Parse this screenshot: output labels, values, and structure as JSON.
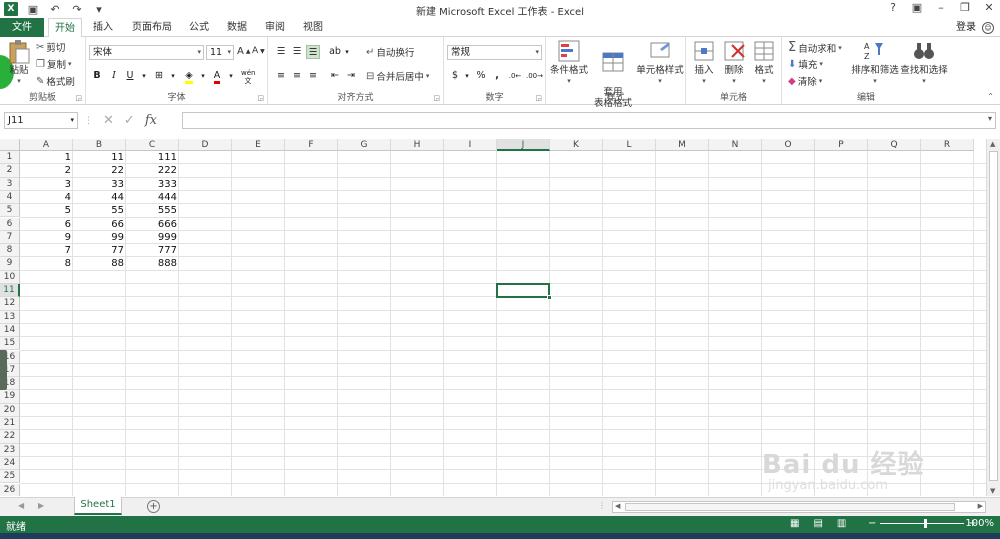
{
  "title_bar": {
    "title": "新建 Microsoft Excel 工作表 - Excel",
    "help": "?",
    "login": "登录"
  },
  "tabs": [
    "文件",
    "开始",
    "插入",
    "页面布局",
    "公式",
    "数据",
    "审阅",
    "视图"
  ],
  "active_tab": "开始",
  "ribbon": {
    "clipboard": {
      "paste": "粘贴",
      "cut": "剪切",
      "copy": "复制",
      "format_painter": "格式刷",
      "label": "剪贴板"
    },
    "font": {
      "name": "宋体",
      "size": "11",
      "bold": "B",
      "italic": "I",
      "underline": "U",
      "font_color": "A",
      "wen": "wén",
      "label": "字体"
    },
    "alignment": {
      "wrap": "自动换行",
      "merge": "合并后居中",
      "label": "对齐方式"
    },
    "number": {
      "format": "常规",
      "percent": "%",
      "comma": ",",
      "label": "数字"
    },
    "styles": {
      "conditional": "条件格式",
      "table": "套用\n表格格式",
      "cell": "单元格样式",
      "label": "样式"
    },
    "cells": {
      "insert": "插入",
      "delete": "删除",
      "format": "格式",
      "label": "单元格"
    },
    "editing": {
      "autosum": "自动求和",
      "fill": "填充",
      "clear": "清除",
      "sort": "排序和筛选",
      "find": "查找和选择",
      "label": "编辑"
    }
  },
  "formula_bar": {
    "name_box": "J11",
    "formula": ""
  },
  "columns": [
    "A",
    "B",
    "C",
    "D",
    "E",
    "F",
    "G",
    "H",
    "I",
    "J",
    "K",
    "L",
    "M",
    "N",
    "O",
    "P",
    "Q",
    "R"
  ],
  "selected_column": "J",
  "rows": [
    "1",
    "2",
    "3",
    "4",
    "5",
    "6",
    "7",
    "8",
    "9",
    "10",
    "11",
    "12",
    "13",
    "14",
    "15",
    "16",
    "17",
    "18",
    "19",
    "20",
    "21",
    "22",
    "23",
    "24",
    "25",
    "26"
  ],
  "selected_row": "11",
  "cells": [
    [
      "1",
      "11",
      "111"
    ],
    [
      "2",
      "22",
      "222"
    ],
    [
      "3",
      "33",
      "333"
    ],
    [
      "4",
      "44",
      "444"
    ],
    [
      "5",
      "55",
      "555"
    ],
    [
      "6",
      "66",
      "666"
    ],
    [
      "9",
      "99",
      "999"
    ],
    [
      "7",
      "77",
      "777"
    ],
    [
      "8",
      "88",
      "888"
    ]
  ],
  "sheet_tabs": {
    "active": "Sheet1",
    "add": "+"
  },
  "status": {
    "text": "就绪",
    "zoom": "100%",
    "zoom_minus": "−",
    "zoom_plus": "+"
  },
  "watermark": {
    "brand": "Bai du 经验",
    "url": "jingyan.baidu.com"
  }
}
